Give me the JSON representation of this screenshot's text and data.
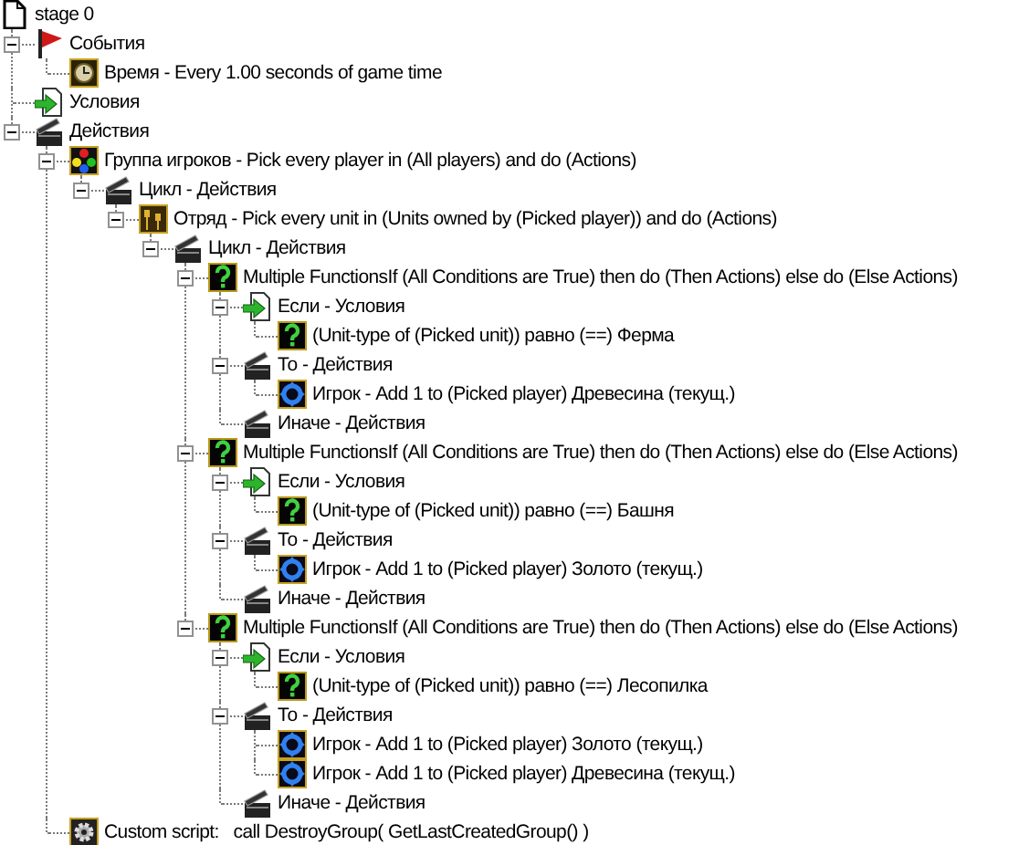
{
  "tree": {
    "label": "stage 0",
    "kind": "document",
    "children": [
      {
        "label": "События",
        "kind": "flag",
        "expanded": true,
        "children": [
          {
            "label": "Время - Every 1.00 seconds of game time",
            "kind": "clock"
          }
        ]
      },
      {
        "label": "Условия",
        "kind": "condition"
      },
      {
        "label": "Действия",
        "kind": "actions",
        "expanded": true,
        "children": [
          {
            "label": "Группа игроков - Pick every player in (All players) and do (Actions)",
            "kind": "players",
            "expanded": true,
            "children": [
              {
                "label": "Цикл - Действия",
                "kind": "actions",
                "expanded": true,
                "children": [
                  {
                    "label": "Отряд - Pick every unit in (Units owned by (Picked player)) and do (Actions)",
                    "kind": "units",
                    "expanded": true,
                    "children": [
                      {
                        "label": "Цикл - Действия",
                        "kind": "actions",
                        "expanded": true,
                        "children": [
                          {
                            "label": "Multiple FunctionsIf (All Conditions are True) then do (Then Actions) else do (Else Actions)",
                            "kind": "question",
                            "expanded": true,
                            "children": [
                              {
                                "label": "Если - Условия",
                                "kind": "condition",
                                "expanded": true,
                                "children": [
                                  {
                                    "label": "(Unit-type of (Picked unit)) равно (==) Ферма",
                                    "kind": "question"
                                  }
                                ]
                              },
                              {
                                "label": "То - Действия",
                                "kind": "actions",
                                "expanded": true,
                                "children": [
                                  {
                                    "label": "Игрок - Add 1 to (Picked player) Древесина (текущ.)",
                                    "kind": "player"
                                  }
                                ]
                              },
                              {
                                "label": "Иначе - Действия",
                                "kind": "actions"
                              }
                            ]
                          },
                          {
                            "label": "Multiple FunctionsIf (All Conditions are True) then do (Then Actions) else do (Else Actions)",
                            "kind": "question",
                            "expanded": true,
                            "children": [
                              {
                                "label": "Если - Условия",
                                "kind": "condition",
                                "expanded": true,
                                "children": [
                                  {
                                    "label": "(Unit-type of (Picked unit)) равно (==) Башня",
                                    "kind": "question"
                                  }
                                ]
                              },
                              {
                                "label": "То - Действия",
                                "kind": "actions",
                                "expanded": true,
                                "children": [
                                  {
                                    "label": "Игрок - Add 1 to (Picked player) Золото (текущ.)",
                                    "kind": "player"
                                  }
                                ]
                              },
                              {
                                "label": "Иначе - Действия",
                                "kind": "actions"
                              }
                            ]
                          },
                          {
                            "label": "Multiple FunctionsIf (All Conditions are True) then do (Then Actions) else do (Else Actions)",
                            "kind": "question",
                            "expanded": true,
                            "children": [
                              {
                                "label": "Если - Условия",
                                "kind": "condition",
                                "expanded": true,
                                "children": [
                                  {
                                    "label": "(Unit-type of (Picked unit)) равно (==) Лесопилка",
                                    "kind": "question"
                                  }
                                ]
                              },
                              {
                                "label": "То - Действия",
                                "kind": "actions",
                                "expanded": true,
                                "children": [
                                  {
                                    "label": "Игрок - Add 1 to (Picked player) Золото (текущ.)",
                                    "kind": "player"
                                  },
                                  {
                                    "label": "Игрок - Add 1 to (Picked player) Древесина (текущ.)",
                                    "kind": "player"
                                  }
                                ]
                              },
                              {
                                "label": "Иначе - Действия",
                                "kind": "actions"
                              }
                            ]
                          }
                        ]
                      }
                    ]
                  }
                ]
              }
            ]
          },
          {
            "label": "Custom script:   call DestroyGroup( GetLastCreatedGroup() )",
            "kind": "script"
          }
        ]
      }
    ]
  }
}
